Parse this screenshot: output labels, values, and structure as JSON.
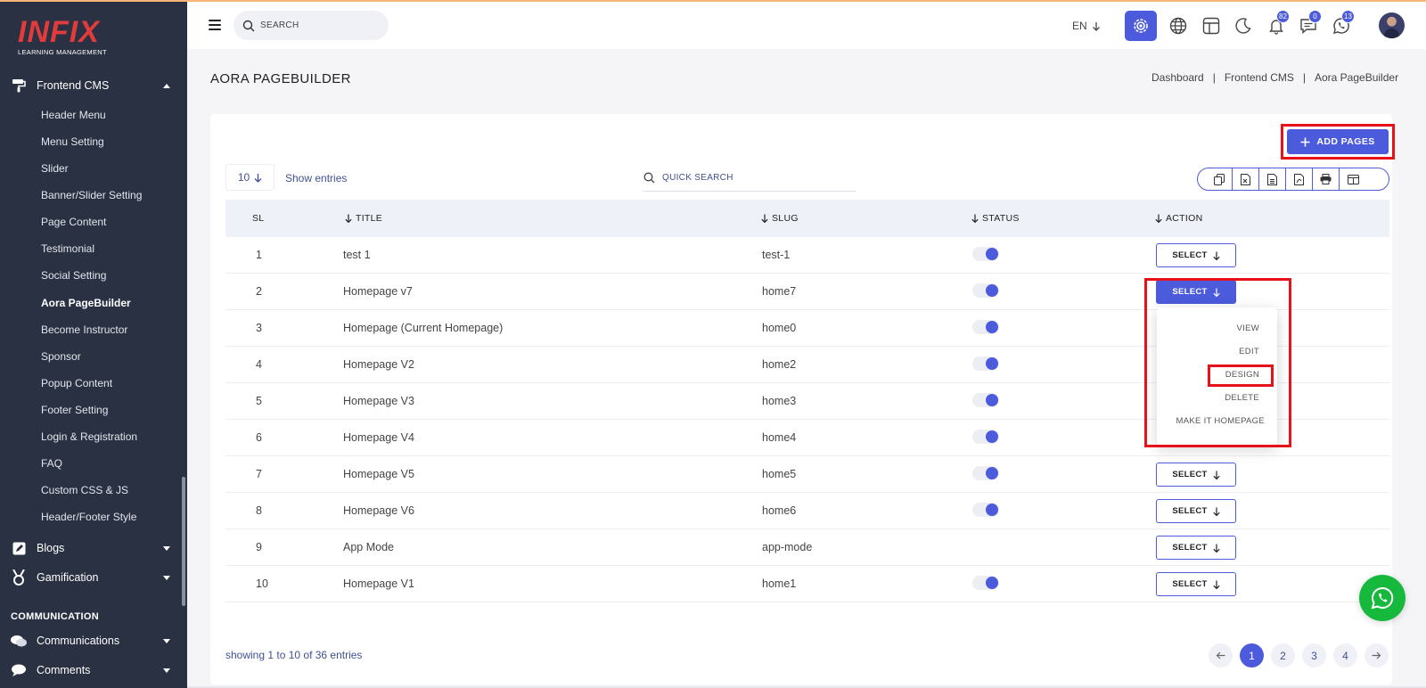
{
  "brand": {
    "logo_text": "INFIX",
    "logo_sub": "LEARNING MANAGEMENT"
  },
  "colors": {
    "accent": "#4c5bdc",
    "sidebar_bg": "#2a3142",
    "highlight": "#e8111a",
    "whatsapp": "#17b93c",
    "logo_red": "#e23b3b"
  },
  "sidebar": {
    "group_frontend": "Frontend CMS",
    "items": [
      {
        "label": "Header Menu"
      },
      {
        "label": "Menu Setting"
      },
      {
        "label": "Slider"
      },
      {
        "label": "Banner/Slider Setting"
      },
      {
        "label": "Page Content"
      },
      {
        "label": "Testimonial"
      },
      {
        "label": "Social Setting"
      },
      {
        "label": "Aora PageBuilder"
      },
      {
        "label": "Become Instructor"
      },
      {
        "label": "Sponsor"
      },
      {
        "label": "Popup Content"
      },
      {
        "label": "Footer Setting"
      },
      {
        "label": "Login & Registration"
      },
      {
        "label": "FAQ"
      },
      {
        "label": "Custom CSS & JS"
      },
      {
        "label": "Header/Footer Style"
      }
    ],
    "active_item": "Aora PageBuilder",
    "group_blogs": "Blogs",
    "group_gamification": "Gamification",
    "section_communication": "COMMUNICATION",
    "group_communications": "Communications",
    "group_comments": "Comments"
  },
  "header": {
    "search_placeholder": "SEARCH",
    "language": "EN",
    "badges": {
      "notifications": "82",
      "messages": "0",
      "whatsapp": "13"
    },
    "icons": [
      "menu-icon",
      "search-icon",
      "gear-icon",
      "globe-icon",
      "layout-icon",
      "moon-icon",
      "bell-icon",
      "chat-icon",
      "whatsapp-icon"
    ]
  },
  "page": {
    "title": "AORA PAGEBUILDER",
    "breadcrumb": [
      "Dashboard",
      "Frontend CMS",
      "Aora PageBuilder"
    ]
  },
  "toolbar": {
    "add_label": "ADD PAGES",
    "entries_value": "10",
    "show_entries": "Show entries",
    "quick_search_placeholder": "QUICK SEARCH",
    "export_icons": [
      "copy-icon",
      "excel-icon",
      "csv-icon",
      "pdf-icon",
      "print-icon",
      "columns-icon"
    ]
  },
  "table": {
    "headers": {
      "sl": "SL",
      "title": "TITLE",
      "slug": "SLUG",
      "status": "STATUS",
      "action": "ACTION"
    },
    "select_label": "SELECT",
    "rows": [
      {
        "sl": "1",
        "title": "test 1",
        "slug": "test-1",
        "status": true
      },
      {
        "sl": "2",
        "title": "Homepage v7",
        "slug": "home7",
        "status": true
      },
      {
        "sl": "3",
        "title": "Homepage (Current Homepage)",
        "slug": "home0",
        "status": true
      },
      {
        "sl": "4",
        "title": "Homepage V2",
        "slug": "home2",
        "status": true
      },
      {
        "sl": "5",
        "title": "Homepage V3",
        "slug": "home3",
        "status": true
      },
      {
        "sl": "6",
        "title": "Homepage V4",
        "slug": "home4",
        "status": true
      },
      {
        "sl": "7",
        "title": "Homepage V5",
        "slug": "home5",
        "status": true
      },
      {
        "sl": "8",
        "title": "Homepage V6",
        "slug": "home6",
        "status": true
      },
      {
        "sl": "9",
        "title": "App Mode",
        "slug": "app-mode",
        "status": false
      },
      {
        "sl": "10",
        "title": "Homepage V1",
        "slug": "home1",
        "status": true
      }
    ],
    "dropdown": [
      "VIEW",
      "EDIT",
      "DESIGN",
      "DELETE",
      "MAKE IT HOMEPAGE"
    ]
  },
  "footer": {
    "showing": "showing 1 to 10 of 36 entries",
    "pages": [
      "1",
      "2",
      "3",
      "4"
    ],
    "current_page": "1"
  }
}
